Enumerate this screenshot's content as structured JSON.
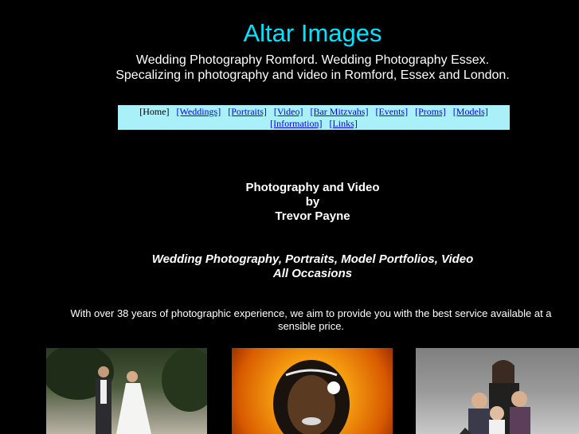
{
  "header": {
    "title": "Altar Images",
    "subtitle_line1": "Wedding Photography Romford. Wedding Photography Essex.",
    "subtitle_line2": "Specalizing in photography and video in Romford, Essex and London."
  },
  "nav": {
    "home": "[Home]",
    "weddings": "[Weddings]",
    "portraits": "[Portraits]",
    "video": "[Video]",
    "bar_mitzvahs": "[Bar Mitzvahs]",
    "events": "[Events]",
    "proms": "[Proms]",
    "models": "[Models]",
    "information": "[Information]",
    "links": "[Links]"
  },
  "byline": {
    "line1": "Photography and Video",
    "line2": "by",
    "line3": "Trevor Payne"
  },
  "services": {
    "line1": "Wedding Photography, Portraits, Model Portfolios, Video",
    "line2": "All Occasions"
  },
  "intro": {
    "text": "With over 38 years of photographic experience, we aim to provide you with the best service available at a sensible price."
  },
  "colors": {
    "background": "#000000",
    "title": "#00e5ff",
    "navbar_bg": "#aaf0f8",
    "link": "#0000ee"
  }
}
